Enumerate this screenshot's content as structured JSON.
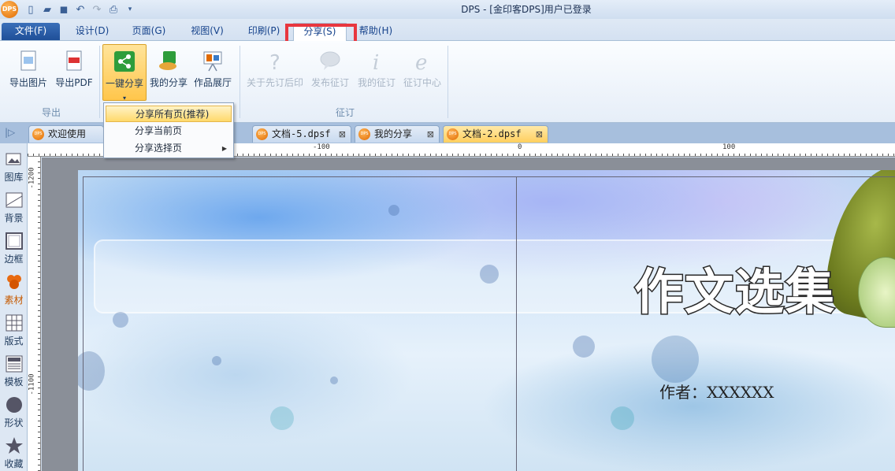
{
  "window": {
    "title": "DPS - [金印客DPS]用户已登录",
    "logo_text": "DPS"
  },
  "ribbon_tabs": [
    {
      "label": "文件(F)"
    },
    {
      "label": "设计(D)"
    },
    {
      "label": "页面(G)"
    },
    {
      "label": "视图(V)"
    },
    {
      "label": "印刷(P)"
    },
    {
      "label": "分享(S)"
    },
    {
      "label": "帮助(H)"
    }
  ],
  "ribbon": {
    "export_group": {
      "label": "导出",
      "image": "导出图片",
      "pdf": "导出PDF"
    },
    "share_group": {
      "one_click": "一键分享",
      "my_share": "我的分享",
      "gallery": "作品展厅"
    },
    "order_group": {
      "label": "征订",
      "about": "关于先订后印",
      "publish": "发布征订",
      "my_order": "我的征订",
      "center": "征订中心"
    }
  },
  "share_menu": [
    {
      "label": "分享所有页(推荐)"
    },
    {
      "label": "分享当前页"
    },
    {
      "label": "分享选择页"
    }
  ],
  "doc_tabs": [
    {
      "label": "欢迎使用DPS软"
    },
    {
      "label": "文档-5.dpsf"
    },
    {
      "label": "我的分享"
    },
    {
      "label": "文档-2.dpsf"
    }
  ],
  "left_panel": [
    {
      "label": "图库",
      "icon": "gallery-icon"
    },
    {
      "label": "背景",
      "icon": "background-icon"
    },
    {
      "label": "边框",
      "icon": "border-icon"
    },
    {
      "label": "素材",
      "icon": "material-icon"
    },
    {
      "label": "版式",
      "icon": "layout-icon"
    },
    {
      "label": "模板",
      "icon": "template-icon"
    },
    {
      "label": "形状",
      "icon": "shape-icon"
    },
    {
      "label": "收藏",
      "icon": "star-icon"
    }
  ],
  "rulers": {
    "top": [
      "-100",
      "0",
      "100"
    ],
    "left": [
      "-1200",
      "-1100"
    ]
  },
  "document": {
    "title": "作文选集",
    "author": "作者：XXXXXX"
  },
  "colors": {
    "accent": "#1f4f98",
    "highlight": "#e8373f",
    "active_tab": "#ffcf5e"
  }
}
